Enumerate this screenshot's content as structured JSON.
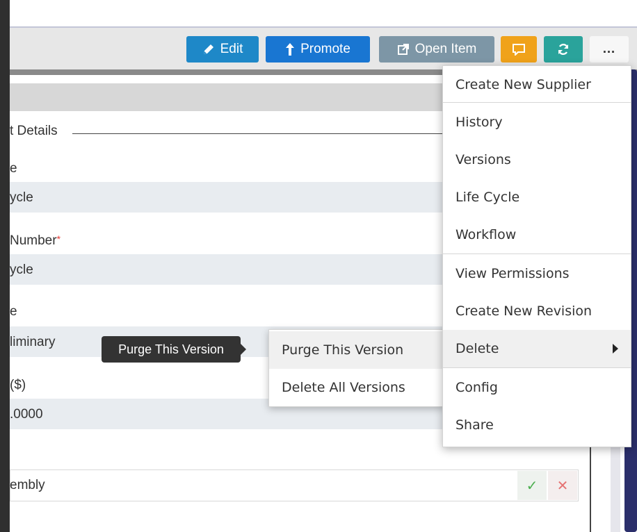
{
  "toolbar": {
    "edit_label": "Edit",
    "promote_label": "Promote",
    "open_item_label": "Open Item",
    "more_label": "…",
    "colors": {
      "edit": "#1e88c8",
      "promote": "#1976d2",
      "open_item": "#7d96a6",
      "comment": "#f0a21a",
      "refresh": "#2aa39b"
    }
  },
  "form": {
    "section_legend": "t Details",
    "fields": [
      {
        "label": "e",
        "value": "ycle"
      },
      {
        "label": "Number",
        "required_mark": "*",
        "value": "ycle"
      },
      {
        "label": "e",
        "value": "liminary"
      },
      {
        "label": "($)",
        "value": ".0000"
      }
    ],
    "bottom_input": {
      "value": "embly",
      "ok_icon": "✓",
      "cancel_icon": "✕"
    }
  },
  "tooltip": {
    "text": "Purge This Version"
  },
  "submenu": {
    "items": [
      {
        "label": "Purge This Version",
        "active": true
      },
      {
        "label": "Delete All Versions"
      }
    ]
  },
  "menu": {
    "items": [
      {
        "label": "Create New Supplier"
      },
      {
        "label": "History"
      },
      {
        "label": "Versions"
      },
      {
        "label": "Life Cycle"
      },
      {
        "label": "Workflow"
      },
      {
        "label": "View Permissions"
      },
      {
        "label": "Create New Revision"
      },
      {
        "label": "Delete",
        "has_submenu": true,
        "active": true
      },
      {
        "label": "Config"
      },
      {
        "label": "Share"
      }
    ]
  }
}
